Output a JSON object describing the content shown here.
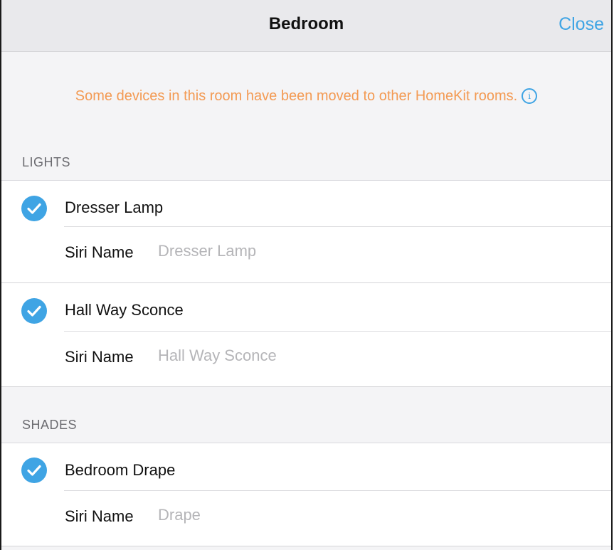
{
  "header": {
    "title": "Bedroom",
    "close_label": "Close"
  },
  "notice": {
    "text": "Some devices in this room have been moved to other HomeKit rooms.",
    "info_icon": "info-circle-icon"
  },
  "sections": [
    {
      "title": "LIGHTS",
      "devices": [
        {
          "name": "Dresser Lamp",
          "checked": true,
          "siri_label": "Siri Name",
          "siri_placeholder": "Dresser Lamp"
        },
        {
          "name": "Hall Way Sconce",
          "checked": true,
          "siri_label": "Siri Name",
          "siri_placeholder": "Hall Way Sconce"
        }
      ]
    },
    {
      "title": "SHADES",
      "devices": [
        {
          "name": "Bedroom Drape",
          "checked": true,
          "siri_label": "Siri Name",
          "siri_placeholder": "Drape"
        }
      ]
    }
  ],
  "colors": {
    "accent": "#3fa4e4",
    "notice": "#f39a53"
  }
}
